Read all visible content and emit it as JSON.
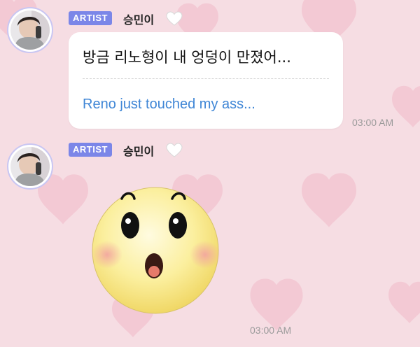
{
  "messages": [
    {
      "badge": "ARTIST",
      "sender": "승민이",
      "text_ko": "방금 리노형이 내 엉덩이 만졌어...",
      "text_en": "Reno just touched my ass...",
      "time": "03:00 AM"
    },
    {
      "badge": "ARTIST",
      "sender": "승민이",
      "sticker_icon": "surprised-emoji-sticker",
      "time": "03:00 AM"
    }
  ],
  "colors": {
    "background": "#f6dde3",
    "background_hearts": "#f2c2cf",
    "badge": "#7b86e8",
    "translation_text": "#3f86d6",
    "avatar_ring": "#c9c6f2"
  }
}
